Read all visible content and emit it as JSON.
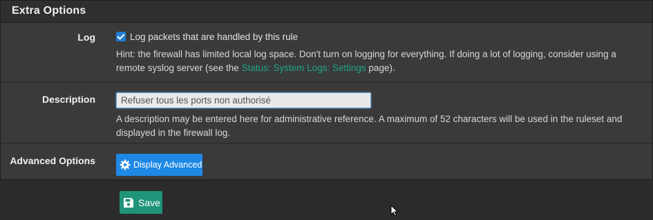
{
  "panel": {
    "title": "Extra Options"
  },
  "log": {
    "label": "Log",
    "checkbox_label": "Log packets that are handled by this rule",
    "checked": true,
    "hint_before": "Hint: the firewall has limited local log space. Don't turn on logging for everything. If doing a lot of logging, consider using a remote syslog server (see the ",
    "hint_link": "Status: System Logs: Settings",
    "hint_after": " page)."
  },
  "description": {
    "label": "Description",
    "value": "Refuser tous les ports non authorisé",
    "help": "A description may be entered here for administrative reference. A maximum of 52 characters will be used in the ruleset and displayed in the firewall log."
  },
  "advanced": {
    "label": "Advanced Options",
    "button_label": "Display Advanced",
    "button_icon": "gear-icon"
  },
  "save": {
    "button_label": "Save",
    "button_icon": "floppy-disk-icon"
  },
  "colors": {
    "accent_blue": "#1e88e5",
    "link_teal": "#1fa58a",
    "save_green": "#1f9478"
  }
}
